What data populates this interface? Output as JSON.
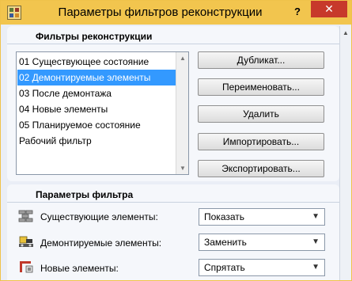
{
  "window": {
    "title": "Параметры фильтров реконструкции",
    "help_label": "?",
    "close_label": "✕"
  },
  "filters_section": {
    "heading": "Фильтры реконструкции",
    "items": [
      {
        "label": "01 Существующее состояние",
        "selected": false
      },
      {
        "label": "02 Демонтируемые элементы",
        "selected": true
      },
      {
        "label": "03 После демонтажа",
        "selected": false
      },
      {
        "label": "04 Новые элементы",
        "selected": false
      },
      {
        "label": "05 Планируемое состояние",
        "selected": false
      },
      {
        "label": "Рабочий фильтр",
        "selected": false
      }
    ],
    "buttons": {
      "duplicate": "Дубликат...",
      "rename": "Переименовать...",
      "delete": "Удалить",
      "import": "Импортировать...",
      "export": "Экспортировать..."
    }
  },
  "params_section": {
    "heading": "Параметры фильтра",
    "rows": [
      {
        "label": "Существующие элементы:",
        "value": "Показать",
        "icon": "existing-elements-icon"
      },
      {
        "label": "Демонтируемые элементы:",
        "value": "Заменить",
        "icon": "demolished-elements-icon"
      },
      {
        "label": "Новые элементы:",
        "value": "Спрятать",
        "icon": "new-elements-icon"
      }
    ]
  },
  "colors": {
    "titlebar": "#f2c54e",
    "close": "#c7392b",
    "selection": "#3399ff"
  }
}
